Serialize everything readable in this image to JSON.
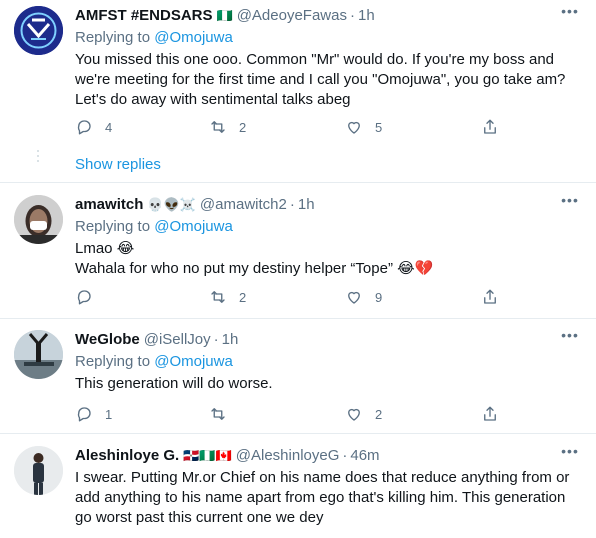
{
  "tweets": [
    {
      "name": "AMFST #ENDSARS",
      "flags": "🇳🇬",
      "handle": "@AdeoyeFawas",
      "dot": "·",
      "time": "1h",
      "replying_prefix": "Replying to",
      "replying_to": "@Omojuwa",
      "text": "You missed this one ooo. Common \"Mr\" would do. If you're my boss and we're meeting for the first time and I call you \"Omojuwa\", you go take am? Let's do away with sentimental talks abeg",
      "replies": "4",
      "retweets": "2",
      "likes": "5"
    },
    {
      "name": "amawitch",
      "flags": "💀👽☠️",
      "handle": "@amawitch2",
      "dot": "·",
      "time": "1h",
      "replying_prefix": "Replying to",
      "replying_to": "@Omojuwa",
      "text_line1": "Lmao 😂",
      "text_line2": "Wahala for who no put my destiny helper “Tope” 😂💔",
      "replies": "",
      "retweets": "2",
      "likes": "9"
    },
    {
      "name": "WeGlobe",
      "flags": "",
      "handle": "@iSellJoy",
      "dot": "·",
      "time": "1h",
      "replying_prefix": "Replying to",
      "replying_to": "@Omojuwa",
      "text": "This generation will do worse.",
      "replies": "1",
      "retweets": "",
      "likes": "2"
    },
    {
      "name": "Aleshinloye G.",
      "flags": "🇩🇴🇳🇬🇨🇦",
      "handle": "@AleshinloyeG",
      "dot": "·",
      "time": "46m",
      "text": "I swear. Putting Mr.or Chief on his name does that reduce anything from or add anything to his name apart from ego that's killing him. This generation go worst past this current one we dey"
    }
  ],
  "show_replies": "Show replies",
  "icons": {
    "reply": "reply-icon",
    "retweet": "retweet-icon",
    "like": "heart-icon",
    "share": "share-icon",
    "more": "more-icon"
  },
  "colors": {
    "link": "#1b95e0",
    "secondary_text": "#5b7083",
    "border": "#e6ecf0"
  }
}
